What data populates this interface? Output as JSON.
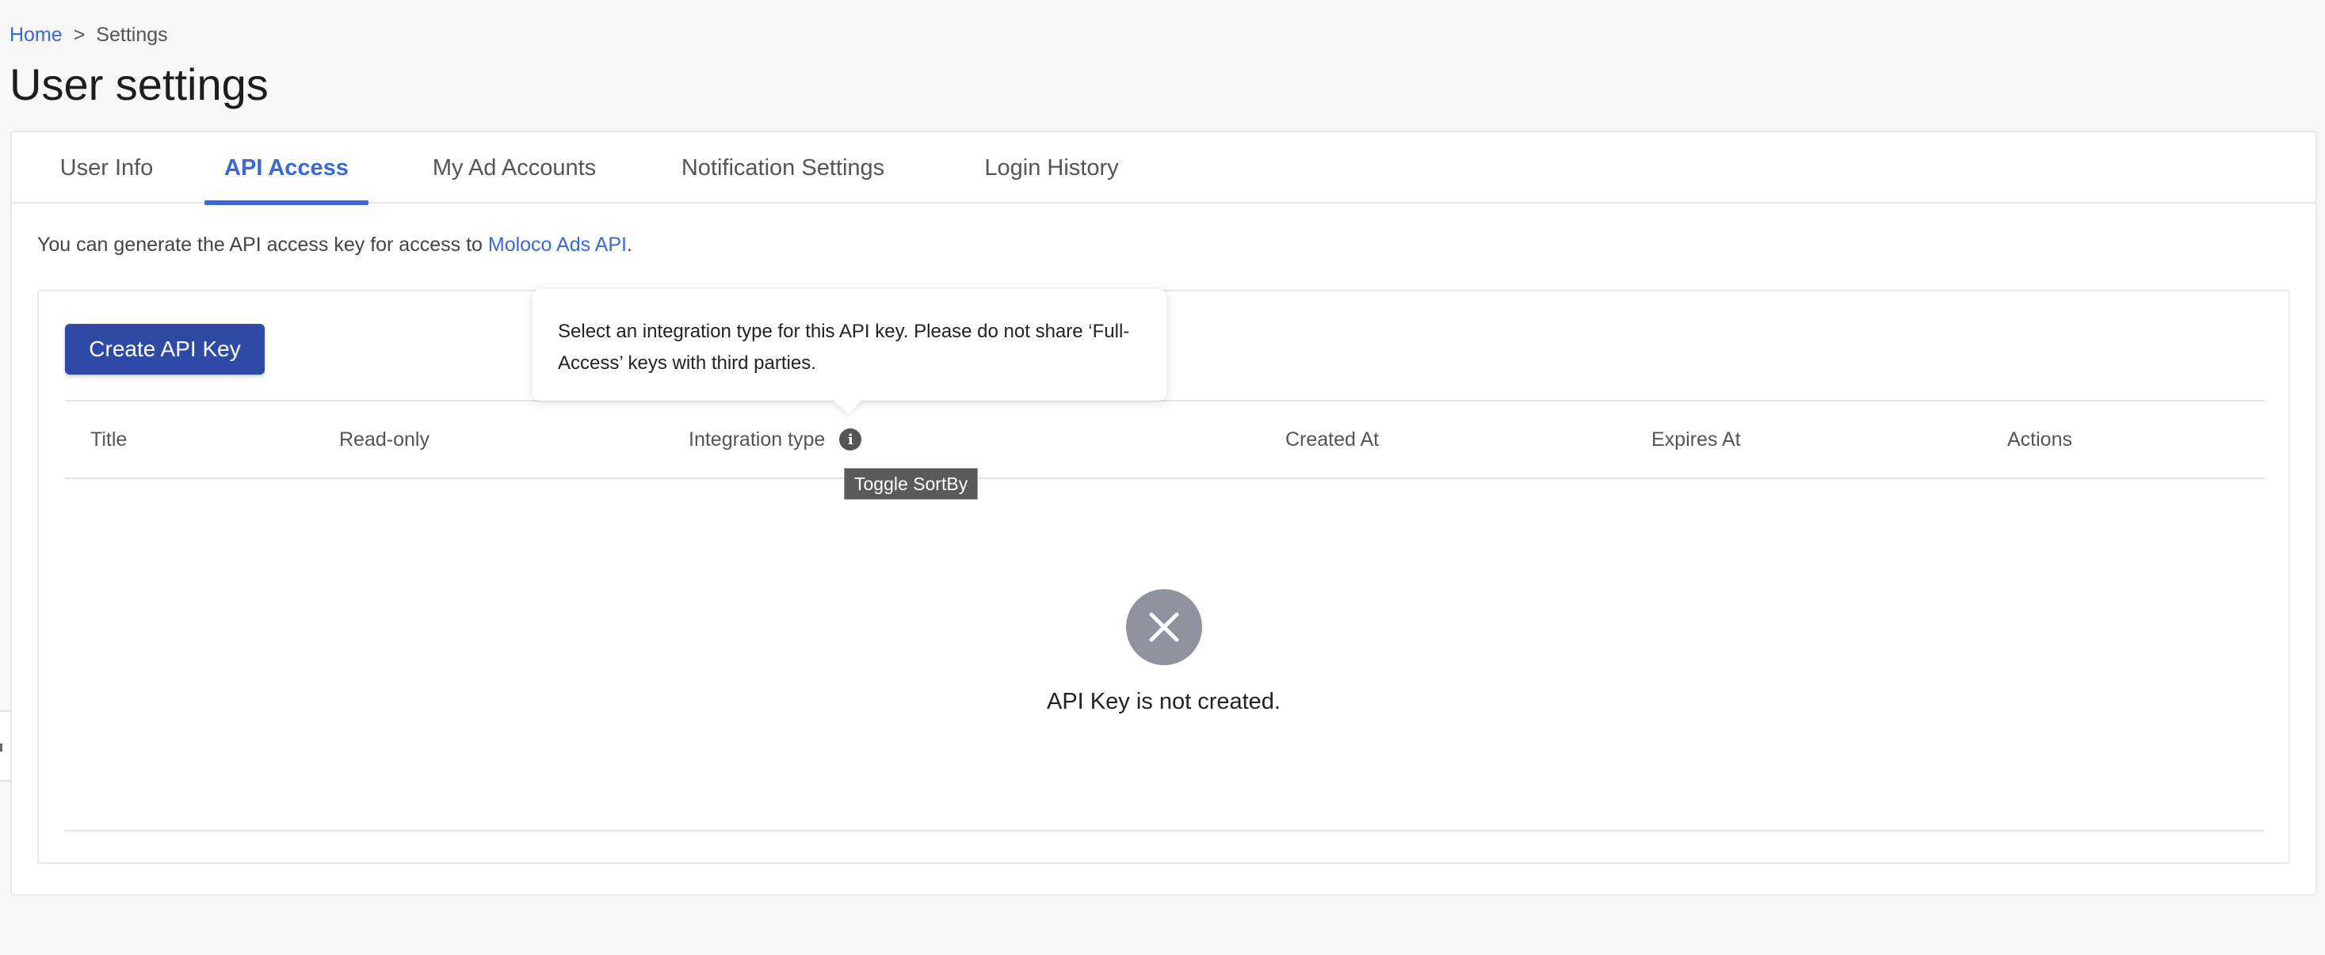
{
  "breadcrumb": {
    "home": "Home",
    "separator": ">",
    "current": "Settings"
  },
  "page": {
    "title": "User settings"
  },
  "tabs": [
    {
      "label": "User Info",
      "active": false
    },
    {
      "label": "API Access",
      "active": true
    },
    {
      "label": "My Ad Accounts",
      "active": false
    },
    {
      "label": "Notification Settings",
      "active": false
    },
    {
      "label": "Login History",
      "active": false
    }
  ],
  "intro": {
    "text": "You can generate the API access key for access to ",
    "link": "Moloco Ads API",
    "suffix": "."
  },
  "toolbar": {
    "create_label": "Create API Key"
  },
  "table": {
    "columns": [
      "Title",
      "Read-only",
      "Integration type",
      "Created At",
      "Expires At",
      "Actions"
    ]
  },
  "empty_state": {
    "text": "API Key is not created."
  },
  "popover": {
    "text": "Select an integration type for this API key. Please do not share ‘Full-Access’ keys with third parties."
  },
  "tooltip": {
    "text": "Toggle SortBy"
  },
  "colors": {
    "accent": "#3b68d4",
    "primary_button": "#2e4aa6",
    "empty_icon": "#8f929f"
  }
}
